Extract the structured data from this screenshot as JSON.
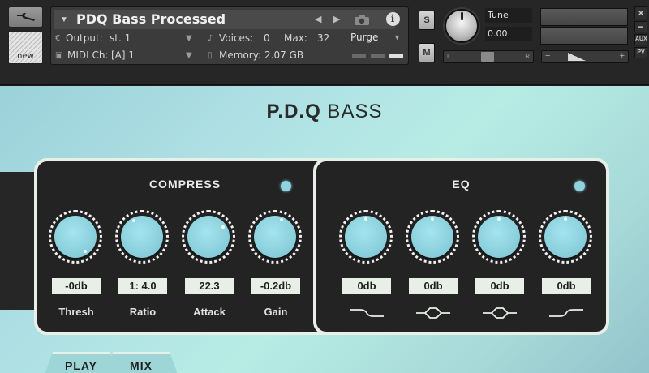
{
  "header": {
    "instrument_name": "PDQ Bass Processed",
    "output_label": "Output:",
    "output_value": "st. 1",
    "voices_label": "Voices:",
    "voices_value": "0",
    "max_label": "Max:",
    "max_value": "32",
    "purge_label": "Purge",
    "midi_label": "MIDI Ch:",
    "midi_value": "[A]  1",
    "memory_label": "Memory:",
    "memory_value": "2.07 GB",
    "new_label": "new",
    "solo_label": "S",
    "mute_label": "M",
    "tune_label": "Tune",
    "tune_value": "0.00",
    "pan_left": "L",
    "pan_right": "R",
    "vol_minus": "−",
    "vol_plus": "+",
    "aux_label": "AUX",
    "pv_label": "PV",
    "close_label": "×",
    "minimize_label": "−"
  },
  "plugin": {
    "title_bold": "P.D.Q",
    "title_rest": " BASS",
    "compress": {
      "title": "COMPRESS",
      "knobs": [
        {
          "label": "Thresh",
          "value": "-0db"
        },
        {
          "label": "Ratio",
          "value": "1: 4.0"
        },
        {
          "label": "Attack",
          "value": "22.3"
        },
        {
          "label": "Gain",
          "value": "-0.2db"
        }
      ]
    },
    "eq": {
      "title": "EQ",
      "bands": [
        {
          "value": "0db",
          "icon": "low-shelf-icon"
        },
        {
          "value": "0db",
          "icon": "bell-icon"
        },
        {
          "value": "0db",
          "icon": "bell-icon"
        },
        {
          "value": "0db",
          "icon": "high-shelf-icon"
        }
      ]
    },
    "tabs": [
      {
        "label": "PLAY"
      },
      {
        "label": "MIX"
      }
    ]
  }
}
